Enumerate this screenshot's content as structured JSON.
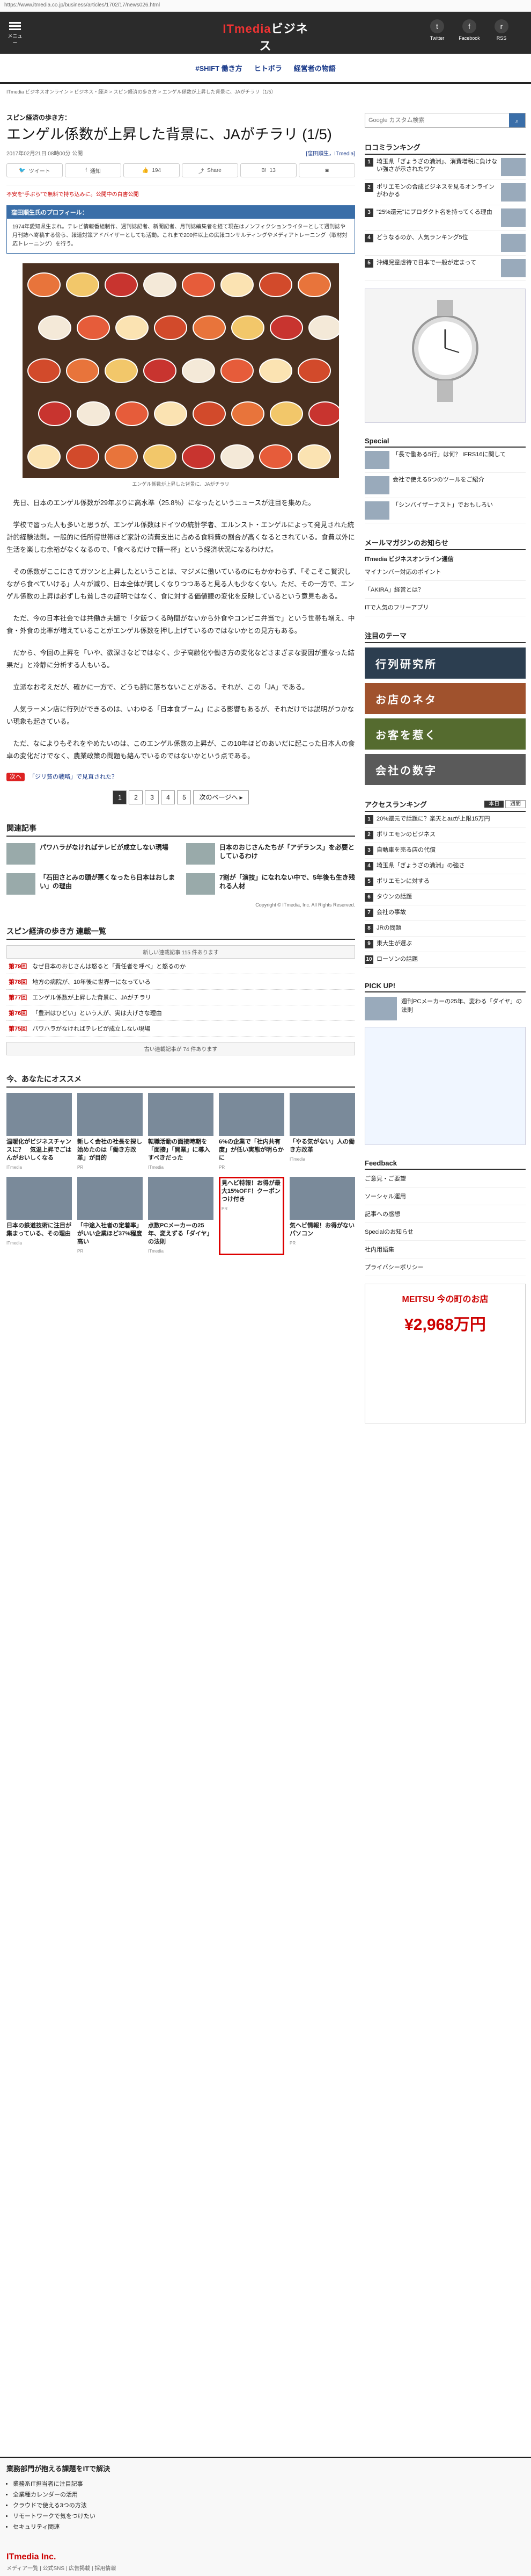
{
  "browser_url": "https://www.itmedia.co.jp/business/articles/1702/17/news026.html",
  "header": {
    "menu_label": "メニュー",
    "logo_main": "ITmedia",
    "logo_accent": "ビジネス",
    "logo_sub": "ONLINE",
    "sns": [
      {
        "label": "Twitter",
        "glyph": "t"
      },
      {
        "label": "Facebook",
        "glyph": "f"
      },
      {
        "label": "RSS",
        "glyph": "r"
      }
    ]
  },
  "nav": [
    "#SHIFT 働き方",
    "ヒトボラ",
    "経営者の物語"
  ],
  "breadcrumb": "ITmedia ビジネスオンライン > ビジネス・経済 > スピン経済の歩き方 > エンゲル係数が上昇した背景に、JAがチラリ（1/5）",
  "article": {
    "kicker": "スピン経済の歩き方：",
    "title": "エンゲル係数が上昇した背景に、JAがチラリ (1/5)",
    "date": "2017年02月21日 08時00分 公開",
    "author": "[窪田順生，ITmedia]",
    "share": [
      {
        "icon": "tw",
        "label": "ツイート"
      },
      {
        "icon": "fb",
        "label": "通知"
      },
      {
        "icon": "lk",
        "label": "194"
      },
      {
        "icon": "sh",
        "label": "Share"
      },
      {
        "icon": "bm",
        "label": "13"
      },
      {
        "icon": "pk",
        "label": ""
      }
    ],
    "pr_link": "不安を“手ぶら”で無料で持ち込みに。公開中の白書公開",
    "box_title": "窪田順生氏のプロフィール：",
    "box_text": "1974年愛知県生まれ。テレビ情報番組制作、週刊誌記者、新聞記者、月刊誌編集者を経て現在はノンフィクションライターとして週刊誌や月刊誌へ寄稿する傍ら、報道対策アドバイザーとしても活動。これまで200件以上の広報コンサルティングやメディアトレーニング（取材対応トレーニング）を行う。",
    "photo_caption": "エンゲル係数が上昇した背景に、JAがチラリ",
    "paragraphs": [
      "先日、日本のエンゲル係数が29年ぶりに高水準（25.8％）になったというニュースが注目を集めた。",
      "学校で習った人も多いと思うが、エンゲル係数はドイツの統計学者、エルンスト・エンゲルによって発見された統計的経験法則。一般的に低所得世帯ほど家計の消費支出に占める食料費の割合が高くなるとされている。食費以外に生活を楽しむ余裕がなくなるので、「食べるだけで精一杯」という経済状況になるわけだ。",
      "その係数がここにきてガツンと上昇したということは、マジメに働いているのにもかかわらず、「そこそこ贅沢しながら食べていける」人々が減り、日本全体が貧しくなりつつあると見る人も少なくない。ただ、その一方で、エンゲル係数の上昇は必ずしも貧しさの証明ではなく、食に対する価値観の変化を反映しているという意見もある。",
      "ただ、今の日本社会では共働き夫婦で「夕飯つくる時間がないから外食やコンビニ弁当で」という世帯も増え、中食・外食の比率が増えていることがエンゲル係数を押し上げているのではないかとの見方もある。",
      "だから、今回の上昇を「いや、欲深さなどではなく、少子高齢化や働き方の変化などさまざまな要因が重なった結果だ」と冷静に分析する人もいる。",
      "立派なお考えだが、確かに一方で、どうも腑に落ちないことがある。それが、この「JA」である。",
      "人気ラーメン店に行列ができるのは、いわゆる「日本食ブーム」による影響もあるが、それだけでは説明がつかない現象も起きている。",
      "ただ、なによりもそれをやめたいのは、このエンゲル係数の上昇が、この10年ほどのあいだに起こった日本人の食卓の変化だけでなく、農業政策の問題も絡んでいるのではないかという点である。"
    ],
    "tag_label": "次へ",
    "tag_text": "「ジリ貧の戦略」で見直された？",
    "pages": [
      "1",
      "2",
      "3",
      "4",
      "5"
    ],
    "next_label": "次のページへ ▸"
  },
  "related": {
    "title": "関連記事",
    "items": [
      "パワハラがなければテレビが成立しない現場",
      "日本のおじさんたちが「アデランス」を必要としているわけ",
      "「石田さとみの頭が悪くなったら日本はおしまい」の理由",
      "7割が「演技」になれない中で、5年後も生き残れる人材"
    ],
    "copyright": "Copyright © ITmedia, Inc. All Rights Reserved."
  },
  "series": {
    "title": "スピン経済の歩き方 連載一覧",
    "count": "新しい連載記事 115 件あります",
    "items": [
      {
        "no": "第79回",
        "t": "なぜ日本のおじさんは怒ると「責任者を呼べ」と怒るのか"
      },
      {
        "no": "第78回",
        "t": "地方の病院が、10年後に世界一になっている"
      },
      {
        "no": "第77回",
        "t": "エンゲル係数が上昇した背景に、JAがチラリ"
      },
      {
        "no": "第76回",
        "t": "「豊洲はひどい」という人が、実は大げさな理由"
      },
      {
        "no": "第75回",
        "t": "パワハラがなければテレビが成立しない現場"
      }
    ],
    "more": "古い連載記事が 74 件あります"
  },
  "recommend": {
    "title": "今、あなたにオススメ",
    "items": [
      {
        "t": "温暖化がビジネスチャンスに？　気温上昇でごはんがおいしくなる",
        "s": "ITmedia"
      },
      {
        "t": "新しく会社の社長を探し始めたのは「働き方改革」が目的",
        "s": "PR"
      },
      {
        "t": "転職活動の面接時期を「面接」「開業」に導入すべきだった",
        "s": "ITmedia"
      },
      {
        "t": "6%の企業で「社内共有度」が低い実態が明らかに",
        "s": "PR"
      },
      {
        "t": "「やる気がない」人の働き方改革",
        "s": "ITmedia"
      },
      {
        "t": "日本の鉄道技術に注目が集まっている、その理由",
        "s": "ITmedia"
      },
      {
        "t": "「中途入社者の定着率」がいい企業ほど37%程度高い",
        "s": "PR"
      },
      {
        "t": "点数PCメーカーの25年、変えずる「ダイヤ」の法則",
        "s": "ITmedia"
      },
      {
        "t": "気ヘビ情報！お得がないパソコン",
        "s": "PR"
      },
      {
        "t": "見ヘビ特報！お得が最大15%OFF！クーポンつけ付き",
        "s": "PR"
      }
    ]
  },
  "sidebar": {
    "search_placeholder": "Google カスタム検索",
    "ranking_title": "ロコミランキング",
    "ranking": [
      "埼玉県「ぎょうざの満洲」、消費増税に負けない強さが示されたワケ",
      "ポリエモンの合成ビジネスを見るオンラインがわかる",
      "\"25%還元\"にプロダクト名を持ってくる理由",
      "どうなるのか、人気ランキング5位",
      "沖縄児童虐待で日本で一般が定まって"
    ],
    "special_title": "Special",
    "special": [
      "「長で働ある5行」は何？ IFRS16に関して",
      "会社で使える5つのツールをご紹介",
      "「シンバイザーナスト」でおもしろい"
    ],
    "mail_title": "メールマガジンのお知らせ",
    "mail_text": "ITmedia ビジネスオンライン通信",
    "mail_items": [
      "マイナンバー対応のポイント",
      "「AKIRA」経営とは？",
      "ITで人気のフリーアプリ"
    ],
    "theme_title": "注目のテーマ",
    "banners": [
      "行列研究所",
      "お店のネタ",
      "お客を惹く",
      "会社の数字"
    ],
    "access_title": "アクセスランキング",
    "access_tabs": [
      "本日",
      "週間"
    ],
    "access": [
      "20%還元で話題に？楽天とauが上限15万円",
      "ポリエモンのビジネス",
      "自動車を売る店の代償",
      "埼玉県「ぎょうざの満洲」の強さ",
      "ポリエモンに対する",
      "タウンの話題",
      "会社の事故",
      "JRの問題",
      "東大生が選ぶ",
      "ローソンの話題"
    ],
    "pickup_title": "PICK UP!",
    "pickup": "週刊PCメーカーの25年、変わる「ダイヤ」の法則",
    "feed_title": "Feedback",
    "feed": [
      "ご意見・ご要望",
      "ソーシャル運用",
      "記事への感想",
      "Specialのお知らせ",
      "社内用語集",
      "プライバシーポリシー"
    ],
    "meitsu_title": "MEITSU 今の町のお店",
    "meitsu_price": "¥2,968万円"
  },
  "footer": {
    "title": "業務部門が抱える課題をITで解決",
    "items": [
      "業務系IT担当者に注目記事",
      "全業種カレンダーの活用",
      "クラウドで使える3つの方法",
      "リモートワークで気をつけたい",
      "セキュリティ関連"
    ],
    "brand": "ITmedia Inc.",
    "legal": "メディア一覧 | 公式SNS | 広告掲載 | 採用情報"
  }
}
